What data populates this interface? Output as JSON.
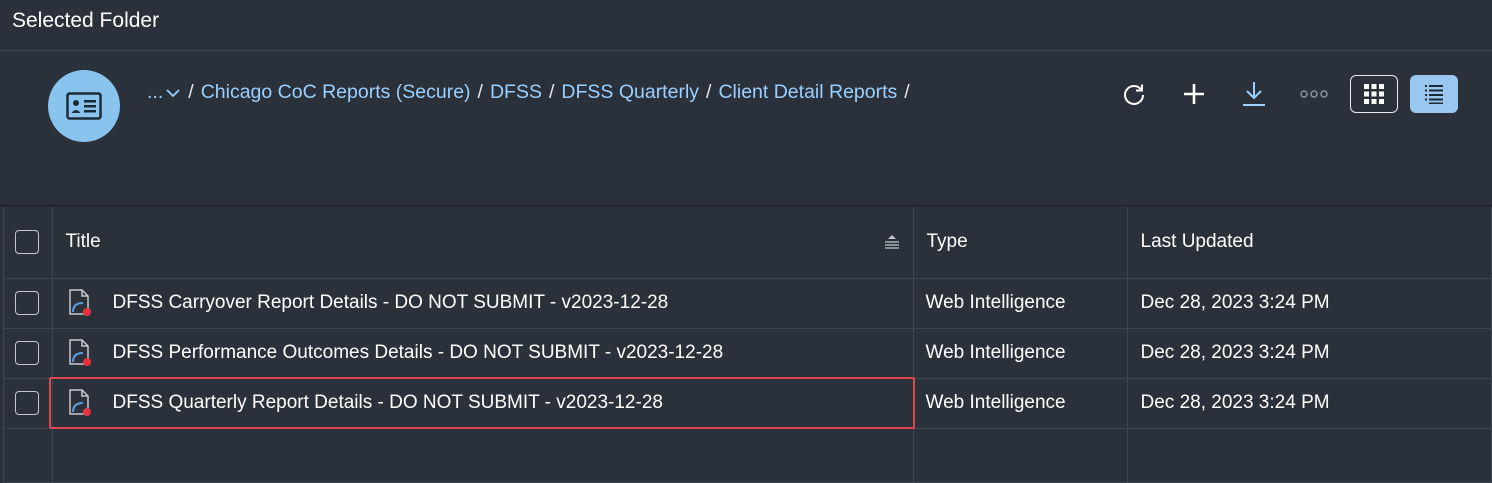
{
  "app": {
    "title": "Selected Folder"
  },
  "folder": {
    "icon": "folder-card-icon"
  },
  "breadcrumb": {
    "more_label": "...",
    "items": [
      "Chicago CoC Reports (Secure)",
      "DFSS",
      "DFSS Quarterly",
      "Client Detail Reports"
    ],
    "separator": "/"
  },
  "toolbar": {
    "refresh_icon": "refresh-icon",
    "add_icon": "plus-icon",
    "download_icon": "download-icon",
    "more_icon": "more-options-icon",
    "tile_view_icon": "grid-view-icon",
    "list_view_icon": "list-view-icon",
    "active_view": "list"
  },
  "table": {
    "columns": {
      "title": "Title",
      "type": "Type",
      "last_updated": "Last Updated"
    },
    "rows": [
      {
        "title": "DFSS Carryover Report Details - DO NOT SUBMIT - v2023-12-28",
        "type": "Web Intelligence",
        "last_updated": "Dec 28, 2023 3:24 PM",
        "checked": false
      },
      {
        "title": "DFSS Performance Outcomes Details - DO NOT SUBMIT - v2023-12-28",
        "type": "Web Intelligence",
        "last_updated": "Dec 28, 2023 3:24 PM",
        "checked": false
      },
      {
        "title": "DFSS Quarterly Report Details - DO NOT SUBMIT - v2023-12-28",
        "type": "Web Intelligence",
        "last_updated": "Dec 28, 2023 3:24 PM",
        "checked": false,
        "highlighted": true
      }
    ]
  },
  "colors": {
    "background": "#2b313b",
    "link": "#9ad0ff",
    "avatar": "#88c4ee",
    "active_view": "#9ac7f0",
    "highlight_outline": "#e0474c",
    "doc_marker": "#e8323c"
  }
}
